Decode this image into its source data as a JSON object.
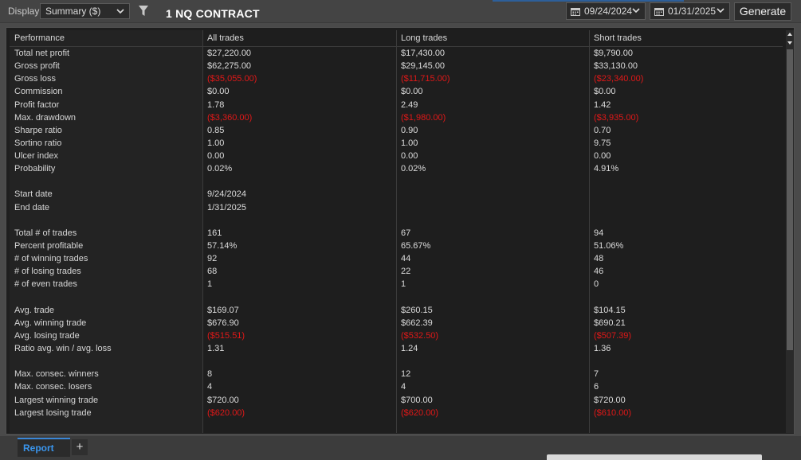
{
  "toolbar": {
    "display_label": "Display",
    "display_value": "Summary ($)",
    "title": "1 NQ CONTRACT",
    "date_from": "09/24/2024",
    "date_to": "01/31/2025",
    "generate_label": "Generate"
  },
  "table": {
    "headers": [
      "Performance",
      "All trades",
      "Long trades",
      "Short trades"
    ],
    "rows": [
      {
        "label": "Total net profit",
        "all": "$27,220.00",
        "long": "$17,430.00",
        "short": "$9,790.00"
      },
      {
        "label": "Gross profit",
        "all": "$62,275.00",
        "long": "$29,145.00",
        "short": "$33,130.00"
      },
      {
        "label": "Gross loss",
        "all": "($35,055.00)",
        "long": "($11,715.00)",
        "short": "($23,340.00)",
        "neg": true
      },
      {
        "label": "Commission",
        "all": "$0.00",
        "long": "$0.00",
        "short": "$0.00"
      },
      {
        "label": "Profit factor",
        "all": "1.78",
        "long": "2.49",
        "short": "1.42"
      },
      {
        "label": "Max. drawdown",
        "all": "($3,360.00)",
        "long": "($1,980.00)",
        "short": "($3,935.00)",
        "neg": true
      },
      {
        "label": "Sharpe ratio",
        "all": "0.85",
        "long": "0.90",
        "short": "0.70"
      },
      {
        "label": "Sortino ratio",
        "all": "1.00",
        "long": "1.00",
        "short": "9.75"
      },
      {
        "label": "Ulcer index",
        "all": "0.00",
        "long": "0.00",
        "short": "0.00"
      },
      {
        "label": "Probability",
        "all": "0.02%",
        "long": "0.02%",
        "short": "4.91%"
      },
      {
        "label": "",
        "all": "",
        "long": "",
        "short": ""
      },
      {
        "label": "Start date",
        "all": "9/24/2024",
        "long": "",
        "short": ""
      },
      {
        "label": "End date",
        "all": "1/31/2025",
        "long": "",
        "short": ""
      },
      {
        "label": "",
        "all": "",
        "long": "",
        "short": ""
      },
      {
        "label": "Total # of trades",
        "all": "161",
        "long": "67",
        "short": "94"
      },
      {
        "label": "Percent profitable",
        "all": "57.14%",
        "long": "65.67%",
        "short": "51.06%"
      },
      {
        "label": "# of winning trades",
        "all": "92",
        "long": "44",
        "short": "48"
      },
      {
        "label": "# of losing trades",
        "all": "68",
        "long": "22",
        "short": "46"
      },
      {
        "label": "# of even trades",
        "all": "1",
        "long": "1",
        "short": "0"
      },
      {
        "label": "",
        "all": "",
        "long": "",
        "short": ""
      },
      {
        "label": "Avg. trade",
        "all": "$169.07",
        "long": "$260.15",
        "short": "$104.15"
      },
      {
        "label": "Avg. winning trade",
        "all": "$676.90",
        "long": "$662.39",
        "short": "$690.21"
      },
      {
        "label": "Avg. losing trade",
        "all": "($515.51)",
        "long": "($532.50)",
        "short": "($507.39)",
        "neg": true
      },
      {
        "label": "Ratio avg. win / avg. loss",
        "all": "1.31",
        "long": "1.24",
        "short": "1.36"
      },
      {
        "label": "",
        "all": "",
        "long": "",
        "short": ""
      },
      {
        "label": "Max. consec. winners",
        "all": "8",
        "long": "12",
        "short": "7"
      },
      {
        "label": "Max. consec. losers",
        "all": "4",
        "long": "4",
        "short": "6"
      },
      {
        "label": "Largest winning trade",
        "all": "$720.00",
        "long": "$700.00",
        "short": "$720.00"
      },
      {
        "label": "Largest losing trade",
        "all": "($620.00)",
        "long": "($620.00)",
        "short": "($610.00)",
        "neg": true
      }
    ]
  },
  "tabs": {
    "report_label": "Report",
    "add_label": "+"
  },
  "colors": {
    "negative": "#e01818",
    "accent": "#3a96ee",
    "background": "#1e1e1e"
  }
}
